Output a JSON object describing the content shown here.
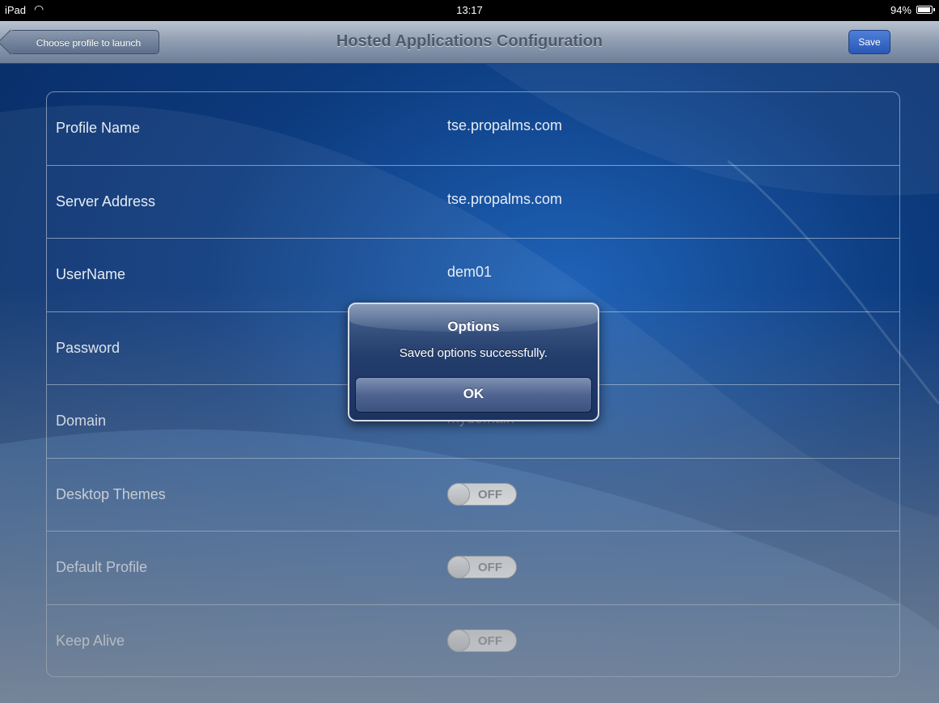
{
  "status_bar": {
    "carrier": "iPad",
    "time": "13:17",
    "battery": "94%"
  },
  "nav": {
    "back_label": "Choose profile to launch",
    "title": "Hosted Applications Configuration",
    "save_label": "Save"
  },
  "settings": {
    "rows": [
      {
        "label": "Profile Name",
        "value": "tse.propalms.com"
      },
      {
        "label": "Server Address",
        "value": "tse.propalms.com"
      },
      {
        "label": "UserName",
        "value": "dem01"
      },
      {
        "label": "Password",
        "value": "●●●●●●●●●"
      },
      {
        "label": "Domain",
        "value": "mydomain"
      },
      {
        "label": "Desktop Themes",
        "toggle": "OFF"
      },
      {
        "label": "Default Profile",
        "toggle": "OFF"
      },
      {
        "label": "Keep Alive",
        "toggle": "OFF"
      }
    ]
  },
  "alert": {
    "title": "Options",
    "message": "Saved options successfully.",
    "ok_label": "OK"
  }
}
